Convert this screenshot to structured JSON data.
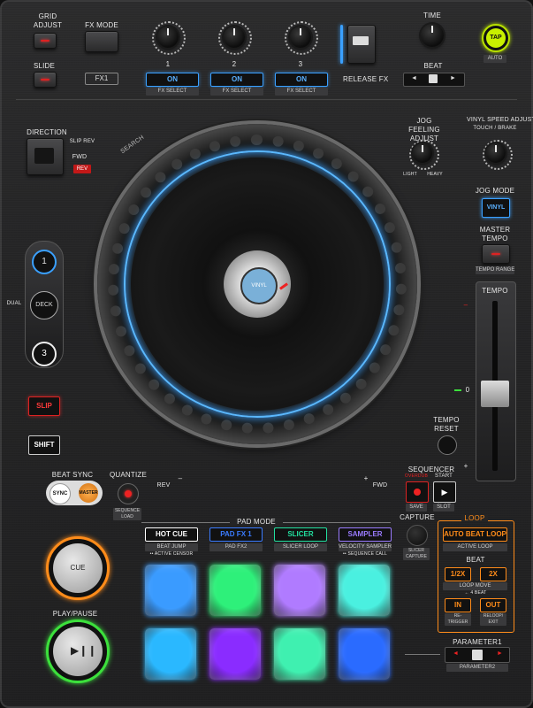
{
  "fx": {
    "grid_adjust": "GRID ADJUST",
    "slide": "SLIDE",
    "fx_mode": "FX MODE",
    "fx1": "FX1",
    "knob_labels": [
      "1",
      "2",
      "3"
    ],
    "on_buttons": [
      "ON",
      "ON",
      "ON"
    ],
    "fx_select": "FX SELECT",
    "time": "TIME",
    "tap": "TAP",
    "auto": "AUTO",
    "release_fx": "RELEASE FX",
    "beat": "BEAT",
    "left_arrow": "◄",
    "right_arrow": "►"
  },
  "left": {
    "direction": "DIRECTION",
    "slip_rev": "SLIP REV",
    "fwd": "FWD",
    "rev": "REV",
    "deck1": "1",
    "deck_label": "DECK",
    "deck3": "3",
    "dual": "DUAL",
    "slip": "SLIP",
    "shift": "SHIFT",
    "beat_sync": "BEAT SYNC",
    "sync": "SYNC",
    "master": "MASTER",
    "quantize": "QUANTIZE",
    "sequence_load": "SEQUENCE LOAD",
    "cue": "CUE",
    "play_pause": "PLAY/PAUSE"
  },
  "jog": {
    "search": "SEARCH",
    "rev": "REV",
    "fwd": "FWD",
    "minus": "–",
    "plus": "+",
    "center_logo": "VINYL"
  },
  "right": {
    "jog_feeling_adjust": "JOG FEELING ADJUST",
    "light": "LIGHT",
    "heavy": "HEAVY",
    "vinyl_speed_adjust": "VINYL SPEED ADJUST",
    "touch_brake": "TOUCH / BRAKE",
    "jog_mode": "JOG MODE",
    "vinyl": "VINYL",
    "master_tempo": "MASTER TEMPO",
    "tempo_range": "TEMPO RANGE",
    "tempo": "TEMPO",
    "tempo_reset": "TEMPO RESET",
    "zero": "0",
    "minus": "–",
    "plus": "+"
  },
  "sequencer": {
    "title": "SEQUENCER",
    "overdub": "OVERDUB",
    "start": "START",
    "save": "SAVE",
    "slot": "SLOT"
  },
  "pad_mode": {
    "title": "PAD MODE",
    "modes": [
      {
        "label": "HOT CUE",
        "sub": "BEAT JUMP",
        "color": "#ffffff"
      },
      {
        "label": "PAD FX 1",
        "sub": "PAD FX2",
        "color": "#3a7bff"
      },
      {
        "label": "SLICER",
        "sub": "SLICER LOOP",
        "color": "#22e0a0"
      },
      {
        "label": "SAMPLER",
        "sub": "VELOCITY SAMPLER",
        "color": "#9a7bff"
      }
    ],
    "active_censor": "•• ACTIVE CENSOR",
    "sequence_call": "•• SEQUENCE CALL",
    "capture": "CAPTURE",
    "slicer_capture": "SLICER CAPTURE",
    "pad_colors": [
      "#3a9bff",
      "#2ef07a",
      "#b07bff",
      "#4af0e0",
      "#2ab8ff",
      "#8a2cff",
      "#3ff0b0",
      "#2a6bff"
    ]
  },
  "loop": {
    "title": "LOOP",
    "auto_beat_loop": "AUTO BEAT LOOP",
    "active_loop": "ACTIVE LOOP",
    "beat": "BEAT",
    "half": "1/2X",
    "double": "2X",
    "loop_move": "LOOP MOVE",
    "four_beat": "← 4 BEAT",
    "in": "IN",
    "out": "OUT",
    "re_trigger": "RE-TRIGGER",
    "reloop_exit": "RELOOP/ EXIT"
  },
  "parameter": {
    "p1": "PARAMETER1",
    "p2": "PARAMETER2",
    "left": "◄",
    "right": "►"
  },
  "colors": {
    "accent_blue": "#3aa0ff",
    "accent_orange": "#ff8c1a",
    "red_led": "#dd2222",
    "tap_green": "#b8e000"
  }
}
